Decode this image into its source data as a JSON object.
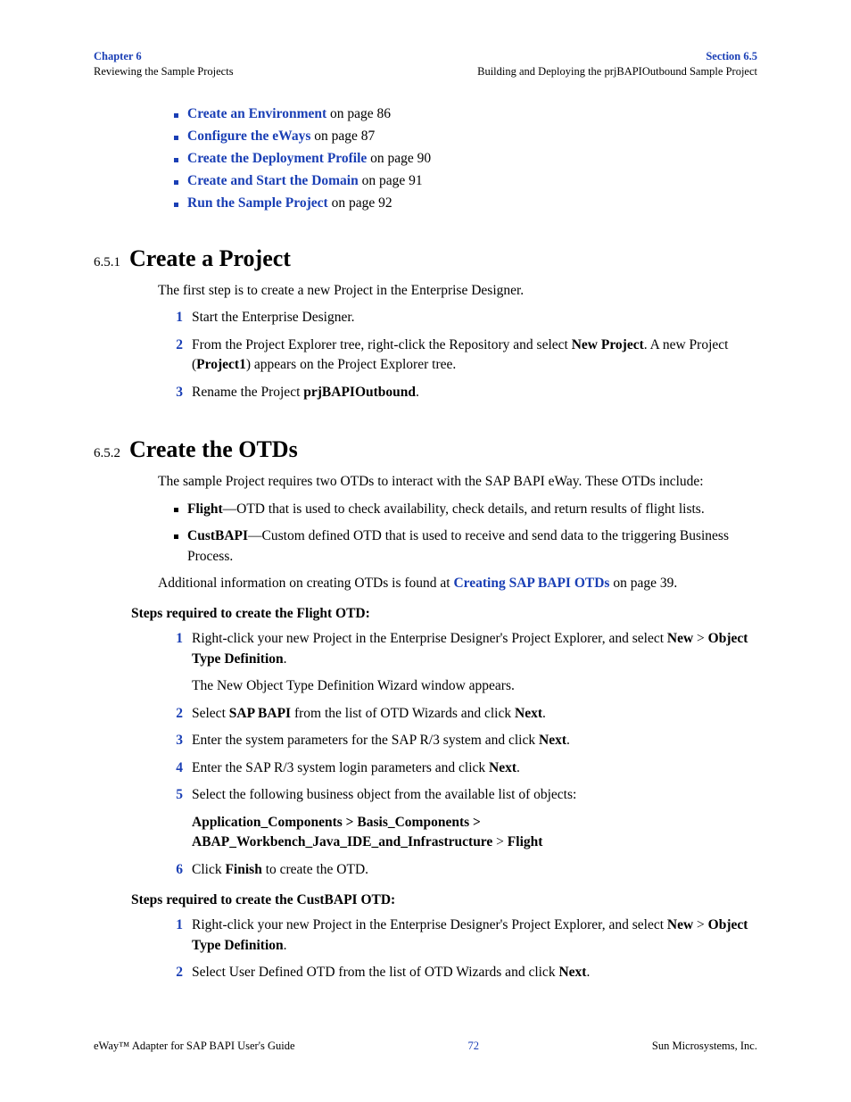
{
  "header": {
    "chapter": "Chapter 6",
    "left_sub": "Reviewing the Sample Projects",
    "section": "Section 6.5",
    "right_sub": "Building and Deploying the prjBAPIOutbound Sample Project"
  },
  "top_links": [
    {
      "link": "Create an Environment",
      "suffix": " on page 86"
    },
    {
      "link": "Configure the eWays",
      "suffix": " on page 87"
    },
    {
      "link": "Create the Deployment Profile",
      "suffix": " on page 90"
    },
    {
      "link": "Create and Start the Domain",
      "suffix": " on page 91"
    },
    {
      "link": "Run the Sample Project",
      "suffix": " on page 92"
    }
  ],
  "sec651": {
    "num": "6.5.1",
    "title": "Create a Project",
    "intro": "The first step is to create a new Project in the Enterprise Designer.",
    "items": {
      "i1": "Start the Enterprise Designer.",
      "i2_a": "From the Project Explorer tree, right-click the Repository and select ",
      "i2_b": "New Project",
      "i2_c": ". A new Project (",
      "i2_d": "Project1",
      "i2_e": ") appears on the Project Explorer tree.",
      "i3_a": "Rename the Project ",
      "i3_b": "prjBAPIOutbound",
      "i3_c": "."
    },
    "nums": {
      "n1": "1",
      "n2": "2",
      "n3": "3"
    }
  },
  "sec652": {
    "num": "6.5.2",
    "title": "Create the OTDs",
    "intro": "The sample Project requires two OTDs to interact with the SAP BAPI eWay. These OTDs include:",
    "bullets": {
      "b1_a": "Flight",
      "b1_b": "—OTD that is used to check availability, check details, and return results of flight lists.",
      "b2_a": "CustBAPI",
      "b2_b": "—Custom defined OTD that is used to receive and send data to the triggering Business Process."
    },
    "addl_a": "Additional information on creating OTDs is found at ",
    "addl_link": "Creating SAP BAPI OTDs",
    "addl_b": " on page 39.",
    "steps_flight_head": "Steps required to create the Flight OTD:",
    "flight": {
      "n1": "1",
      "n2": "2",
      "n3": "3",
      "n4": "4",
      "n5": "5",
      "n6": "6",
      "i1_a": "Right-click your new Project in the Enterprise Designer's Project Explorer, and select ",
      "i1_b": "New",
      "i1_gt": " > ",
      "i1_c": "Object Type Definition",
      "i1_d": ".",
      "i1_note": "The New Object Type Definition Wizard window appears.",
      "i2_a": "Select ",
      "i2_b": "SAP BAPI",
      "i2_c": " from the list of OTD Wizards and click ",
      "i2_d": "Next",
      "i2_e": ".",
      "i3_a": "Enter the system parameters for the SAP R/3 system and click ",
      "i3_b": "Next",
      "i3_c": ".",
      "i4_a": "Enter the SAP R/3 system login parameters and click ",
      "i4_b": "Next",
      "i4_c": ".",
      "i5": "Select the following business object from the available list of objects:",
      "i5_path_a": "Application_Components > Basis_Components > ABAP_Workbench_Java_IDE_and_Infrastructure",
      "i5_path_gt": " > ",
      "i5_path_b": "Flight",
      "i6_a": "Click ",
      "i6_b": "Finish",
      "i6_c": " to create the OTD."
    },
    "steps_cust_head": "Steps required to create the CustBAPI OTD:",
    "cust": {
      "n1": "1",
      "n2": "2",
      "i1_a": "Right-click your new Project in the Enterprise Designer's Project Explorer, and select ",
      "i1_b": "New",
      "i1_gt": " > ",
      "i1_c": "Object Type Definition",
      "i1_d": ".",
      "i2_a": "Select User Defined OTD from the list of OTD Wizards and click ",
      "i2_b": "Next",
      "i2_c": "."
    }
  },
  "footer": {
    "left": "eWay™ Adapter for SAP BAPI User's Guide",
    "center": "72",
    "right": "Sun Microsystems, Inc."
  }
}
